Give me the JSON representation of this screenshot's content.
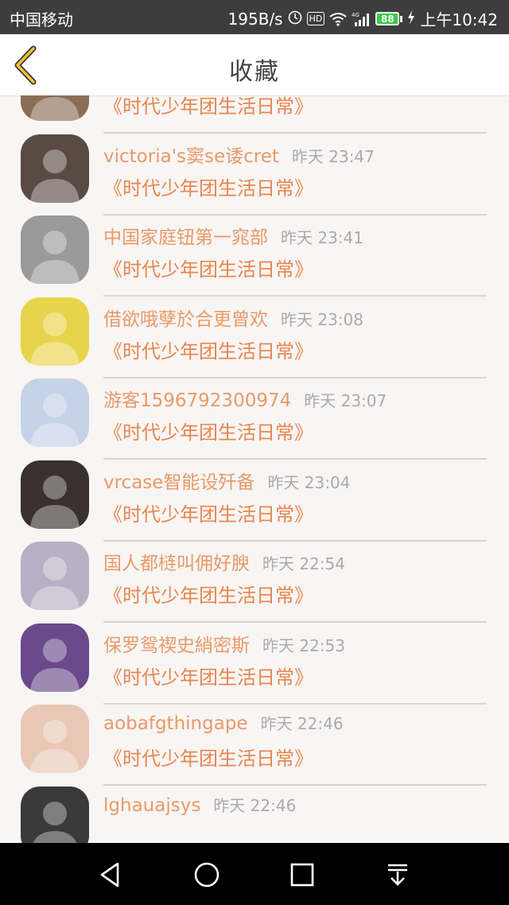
{
  "status_bar": {
    "carrier": "中国移动",
    "net_speed": "195B/s",
    "hd_label": "HD",
    "signal_label": "4G",
    "battery": "88",
    "time": "上午10:42"
  },
  "header": {
    "title": "收藏",
    "back_icon": "chevron-left-icon"
  },
  "favorites": [
    {
      "name": "",
      "time": "",
      "work": "《时代少年团生活日常》",
      "avatar_color": "#8a6d55"
    },
    {
      "name": "victoria's窦se诿cret",
      "time": "昨天 23:47",
      "work": "《时代少年团生活日常》",
      "avatar_color": "#5a4a44"
    },
    {
      "name": "中国家庭钮第一窕部",
      "time": "昨天 23:41",
      "work": "《时代少年团生活日常》",
      "avatar_color": "#9a9a9a"
    },
    {
      "name": "借欲哦孽於合更曾欢",
      "time": "昨天 23:08",
      "work": "《时代少年团生活日常》",
      "avatar_color": "#e8d44a"
    },
    {
      "name": "游客1596792300974",
      "time": "昨天 23:07",
      "work": "《时代少年团生活日常》",
      "avatar_color": "#c5d2e8"
    },
    {
      "name": "vrcase智能设歼备",
      "time": "昨天 23:04",
      "work": "《时代少年团生活日常》",
      "avatar_color": "#3a3030"
    },
    {
      "name": "国人都梿叫佣好腴",
      "time": "昨天 22:54",
      "work": "《时代少年团生活日常》",
      "avatar_color": "#b8b0c4"
    },
    {
      "name": "保罗鸳禊史綃密斯",
      "time": "昨天 22:53",
      "work": "《时代少年团生活日常》",
      "avatar_color": "#6a4a8a"
    },
    {
      "name": "aobafgthingape",
      "time": "昨天 22:46",
      "work": "《时代少年团生活日常》",
      "avatar_color": "#e8c8b4"
    },
    {
      "name": "lghauajsys",
      "time": "昨天 22:46",
      "work": "",
      "avatar_color": "#3a3a3a"
    }
  ],
  "nav_bar": {
    "back": "triangle-back-icon",
    "home": "circle-home-icon",
    "recents": "square-recents-icon",
    "notifications": "pull-down-icon"
  }
}
